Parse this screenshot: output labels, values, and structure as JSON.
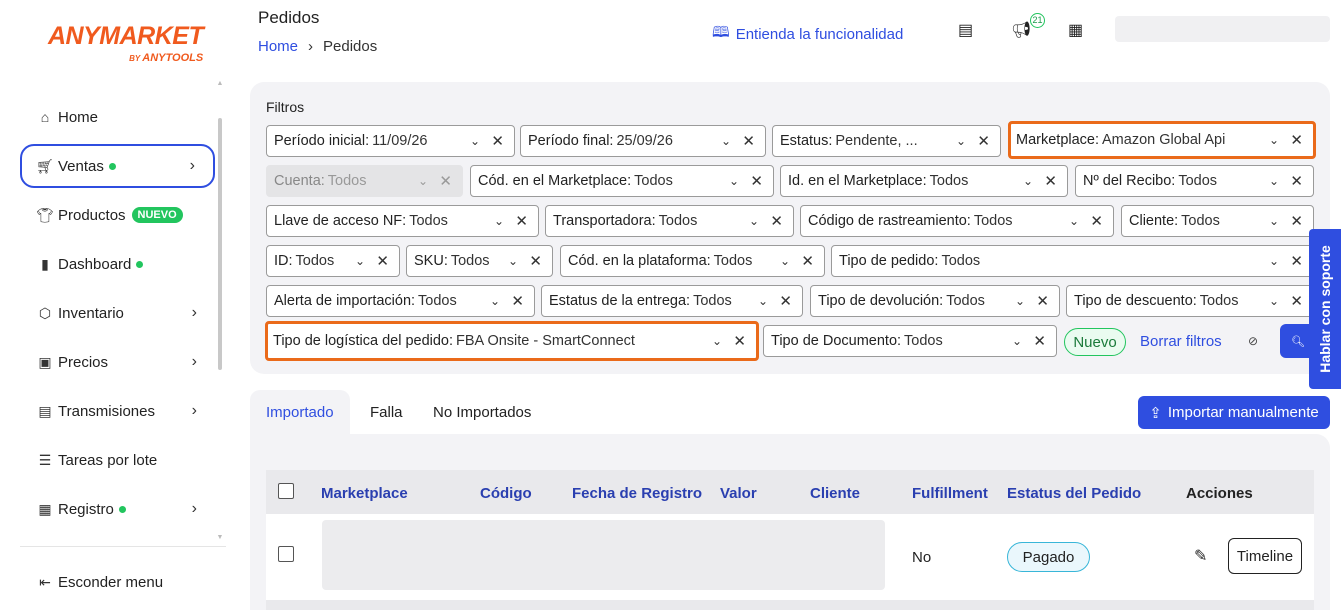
{
  "brand": {
    "name": "ANYMARKET",
    "by": "BY",
    "parent": "ANYTOOLS",
    "color": "#f05a1e"
  },
  "sidebar": {
    "items": [
      {
        "label": "Home",
        "icon": "home-icon"
      },
      {
        "label": "Ventas",
        "icon": "cart-icon",
        "dot": true,
        "chevron": true,
        "active": true
      },
      {
        "label": "Productos",
        "icon": "shirt-icon",
        "badge": "NUEVO"
      },
      {
        "label": "Dashboard",
        "icon": "bar-chart-icon",
        "dot": true
      },
      {
        "label": "Inventario",
        "icon": "box-icon",
        "chevron": true
      },
      {
        "label": "Precios",
        "icon": "money-icon",
        "chevron": true
      },
      {
        "label": "Transmisiones",
        "icon": "store-icon",
        "chevron": true
      },
      {
        "label": "Tareas por lote",
        "icon": "list-icon"
      },
      {
        "label": "Registro",
        "icon": "clipboard-icon",
        "dot": true,
        "chevron": true
      }
    ],
    "hide_menu": "Esconder menu"
  },
  "header": {
    "title": "Pedidos",
    "breadcrumb": {
      "home": "Home",
      "separator": "›",
      "current": "Pedidos"
    },
    "understand_link": "Entienda la funcionalidad",
    "notifications_count": "21"
  },
  "filters": {
    "title": "Filtros",
    "chips": [
      {
        "label": "Período inicial:",
        "value": "11/09/26"
      },
      {
        "label": "Período final:",
        "value": "25/09/26"
      },
      {
        "label": "Estatus:",
        "value": "Pendente, ..."
      },
      {
        "label": "Marketplace:",
        "value": "Amazon Global Api"
      },
      {
        "label": "Cuenta:",
        "value": "Todos"
      },
      {
        "label": "Cód. en el Marketplace:",
        "value": "Todos"
      },
      {
        "label": "Id. en el Marketplace:",
        "value": "Todos"
      },
      {
        "label": "Nº del Recibo:",
        "value": "Todos"
      },
      {
        "label": "Llave de acceso NF:",
        "value": "Todos"
      },
      {
        "label": "Transportadora:",
        "value": "Todos"
      },
      {
        "label": "Código de rastreamiento:",
        "value": "Todos"
      },
      {
        "label": "Cliente:",
        "value": "Todos"
      },
      {
        "label": "ID:",
        "value": "Todos"
      },
      {
        "label": "SKU:",
        "value": "Todos"
      },
      {
        "label": "Cód. en la plataforma:",
        "value": "Todos"
      },
      {
        "label": "Tipo de pedido:",
        "value": "Todos"
      },
      {
        "label": "Alerta de importación:",
        "value": "Todos"
      },
      {
        "label": "Estatus de la entrega:",
        "value": "Todos"
      },
      {
        "label": "Tipo de devolución:",
        "value": "Todos"
      },
      {
        "label": "Tipo de descuento:",
        "value": "Todos"
      },
      {
        "label": "Tipo de logística del pedido:",
        "value": "FBA Onsite - SmartConnect"
      },
      {
        "label": "Tipo de Documento:",
        "value": "Todos"
      }
    ],
    "new_button": "Nuevo",
    "clear_button": "Borrar filtros"
  },
  "support_tab": "Hablar con soporte",
  "tabs": [
    "Importado",
    "Falla",
    "No Importados"
  ],
  "import_button": "Importar manualmente",
  "table": {
    "columns": [
      "Marketplace",
      "Código",
      "Fecha de Registro",
      "Valor",
      "Cliente",
      "Fulfillment",
      "Estatus del Pedido",
      "Acciones"
    ],
    "rows": [
      {
        "fulfillment": "No",
        "status": "Pagado",
        "action": "Timeline"
      }
    ]
  },
  "colors": {
    "accent": "#2f4ee0",
    "highlight": "#ea6a1a",
    "success": "#22c55e",
    "status_border": "#38b6d8"
  }
}
